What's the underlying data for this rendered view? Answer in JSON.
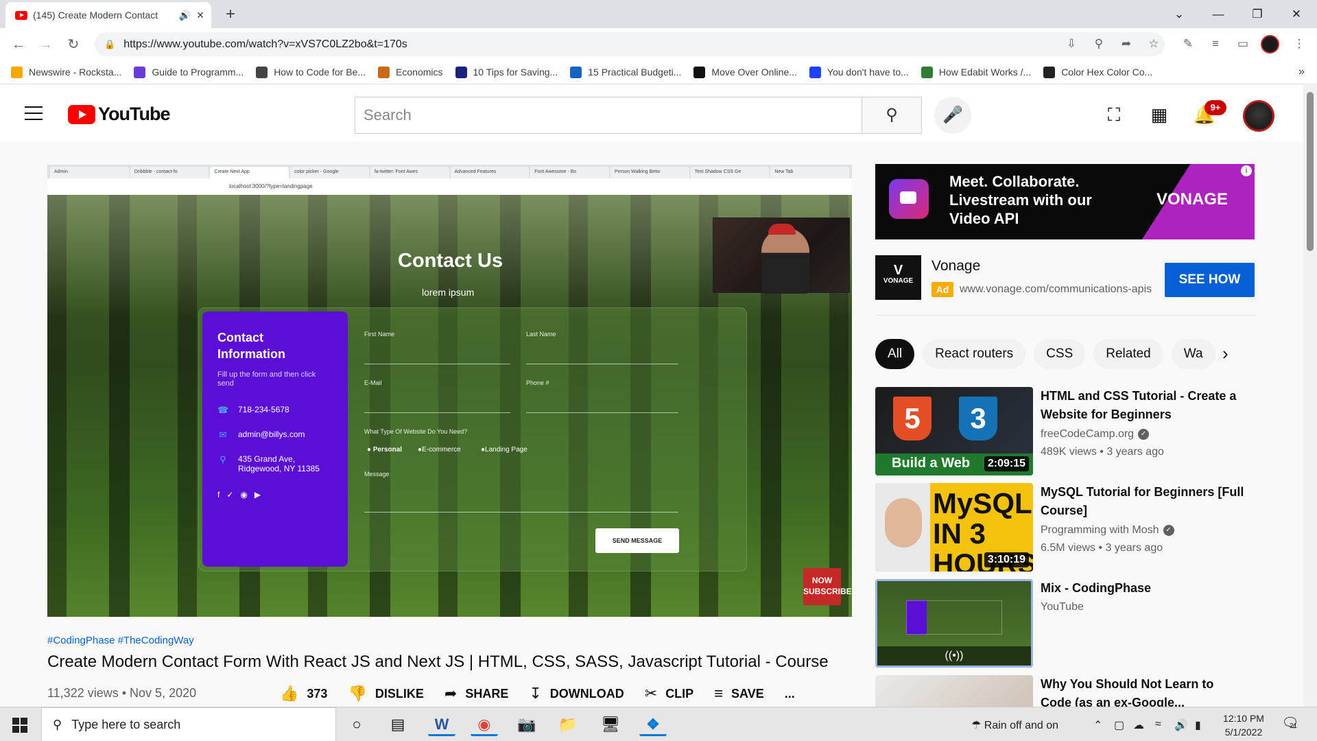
{
  "browser": {
    "tab_title": "(145) Create Modern Contact",
    "new_tab_symbol": "+",
    "url": "https://www.youtube.com/watch?v=xVS7C0LZ2bo&t=170s"
  },
  "bookmarks": [
    {
      "label": "Newswire - Rocksta...",
      "icon": "rockstar-icon",
      "color": "#f6a800"
    },
    {
      "label": "Guide to Programm...",
      "icon": "guide-icon",
      "color": "#6c3dd6"
    },
    {
      "label": "How to Code for Be...",
      "icon": "shield-icon",
      "color": "#444444"
    },
    {
      "label": "Economics",
      "icon": "fox-icon",
      "color": "#c56b1a"
    },
    {
      "label": "10 Tips for Saving...",
      "icon": "bookmark-icon",
      "color": "#1a237e"
    },
    {
      "label": "15 Practical Budgeti...",
      "icon": "r-icon",
      "color": "#1565c0"
    },
    {
      "label": "Move Over Online...",
      "icon": "f-icon",
      "color": "#111111"
    },
    {
      "label": "You don't have to...",
      "icon": "diamond-icon",
      "color": "#1e40ff"
    },
    {
      "label": "How Edabit Works /...",
      "icon": "edabit-icon",
      "color": "#2e7d32"
    },
    {
      "label": "Color Hex Color Co...",
      "icon": "ch-icon",
      "color": "#222222"
    }
  ],
  "youtube": {
    "logo_text": "YouTube",
    "search_placeholder": "Search",
    "notification_count": "9+"
  },
  "video_frame": {
    "inner_tabs": [
      "Admin",
      "Dribbble - contact-fo",
      "Create Next App",
      "color picker - Google",
      "fa-twitter: Font Awes",
      "Advanced Features",
      "Font Awesome - Bo",
      "Person Walking Betw",
      "Text Shadow CSS Ge",
      "New Tab"
    ],
    "inner_url": "localhost:3000/?type=landingpage",
    "heading": "Contact Us",
    "subheading": "lorem ipsum",
    "contact_title": "Contact Information",
    "contact_note": "Fill up the form and then click send",
    "phone": "718-234-5678",
    "email": "admin@billys.com",
    "address": "435 Grand Ave, Ridgewood, NY 11385",
    "labels": {
      "first_name": "First Name",
      "last_name": "Last Name",
      "email": "E-Mail",
      "phone": "Phone #",
      "website_type": "What Type Of Website Do You Need?",
      "message": "Message"
    },
    "options": [
      "Personal",
      "E-commerce",
      "Landing Page"
    ],
    "send_button": "SEND MESSAGE",
    "subscribe_badge": "NOW SUBSCRIBE"
  },
  "video_info": {
    "hashtags": "#CodingPhase #TheCodingWay",
    "title": "Create Modern Contact Form With React JS and Next JS | HTML, CSS, SASS, Javascript Tutorial - Course",
    "views": "11,322 views",
    "date": "Nov 5, 2020",
    "likes": "373",
    "dislike": "DISLIKE",
    "share": "SHARE",
    "download": "DOWNLOAD",
    "clip": "CLIP",
    "save": "SAVE",
    "more": "..."
  },
  "ad": {
    "tagline": "Meet. Collaborate. Livestream with our Video API",
    "brand_logo": "VONAGE",
    "name": "Vonage",
    "badge": "Ad",
    "url": "www.vonage.com/communications-apis",
    "cta": "SEE HOW",
    "accent": "#c026d3"
  },
  "chips": [
    "All",
    "React routers",
    "CSS",
    "Related",
    "Wa"
  ],
  "related": [
    {
      "title": "HTML and CSS Tutorial - Create a Website for Beginners",
      "channel": "freeCodeCamp.org",
      "meta": "489K views • 3 years ago",
      "duration": "2:09:15",
      "thumb_text": "Build a Web",
      "verified": true
    },
    {
      "title": "MySQL Tutorial for Beginners [Full Course]",
      "channel": "Programming with Mosh",
      "meta": "6.5M views • 3 years ago",
      "duration": "3:10:19",
      "thumb_text": "MySQL IN 3 HOURS",
      "verified": true
    },
    {
      "title": "Mix - CodingPhase",
      "channel": "YouTube",
      "meta": "",
      "duration": "",
      "thumb_text": "",
      "verified": false
    },
    {
      "title": "Why You Should Not Learn to Code (as an ex-Google...",
      "channel": "",
      "meta": "",
      "duration": "",
      "thumb_text": "",
      "verified": false
    }
  ],
  "taskbar": {
    "search_placeholder": "Type here to search",
    "weather": "Rain off and on",
    "time": "12:10 PM",
    "date": "5/1/2022",
    "notification_count": "21"
  }
}
